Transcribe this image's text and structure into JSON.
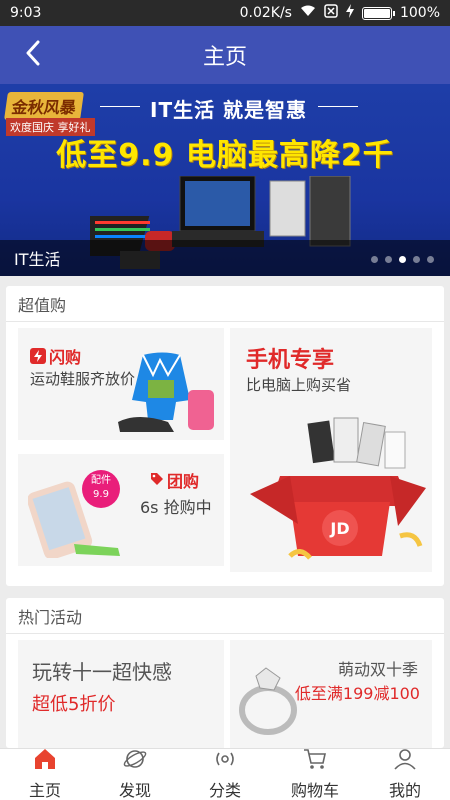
{
  "status": {
    "time": "9:03",
    "speed": "0.02K/s",
    "battery": "100%",
    "battery_level": 1.0
  },
  "header": {
    "title": "主页"
  },
  "banner": {
    "tag_main": "金秋风暴",
    "tag_sub": "欢度国庆 享好礼",
    "subtitle": "IT生活  就是智惠",
    "headline": "低至9.9 电脑最高降2千",
    "caption": "IT生活",
    "dot_count": 5,
    "active_dot": 2
  },
  "value_section": {
    "title": "超值购",
    "flash": {
      "label": "闪购",
      "tagline": "运动鞋服齐放价"
    },
    "group": {
      "label": "团购",
      "tagline": "6s 抢购中",
      "badge_title": "配件",
      "badge_price": "9.9"
    },
    "phone": {
      "title": "手机专享",
      "tagline": "比电脑上购买省",
      "logo": "JD"
    }
  },
  "activity_section": {
    "title": "热门活动",
    "left": {
      "title": "玩转十一超快感",
      "promo": "超低5折价"
    },
    "right": {
      "title": "萌动双十季",
      "promo": "低至满199减100"
    }
  },
  "tabbar": {
    "items": [
      {
        "label": "主页",
        "icon": "home-icon"
      },
      {
        "label": "发现",
        "icon": "planet-icon"
      },
      {
        "label": "分类",
        "icon": "broadcast-icon"
      },
      {
        "label": "购物车",
        "icon": "cart-icon"
      },
      {
        "label": "我的",
        "icon": "user-icon"
      }
    ],
    "active_index": 0,
    "accent": "#e8432f"
  },
  "colors": {
    "primary": "#3f51b5",
    "accent_red": "#e02a2a"
  }
}
